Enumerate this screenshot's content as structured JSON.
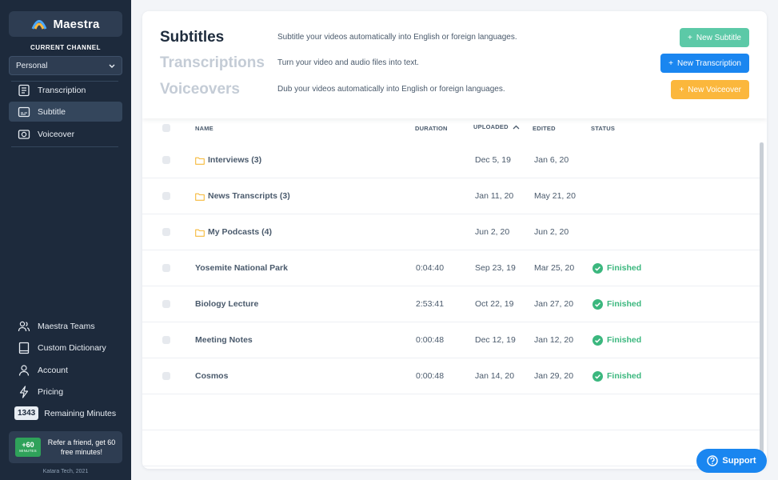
{
  "sidebar": {
    "brand": "Maestra",
    "channel_label": "CURRENT CHANNEL",
    "channel_value": "Personal",
    "nav": [
      {
        "label": "Transcription",
        "icon": "document-icon",
        "active": false
      },
      {
        "label": "Subtitle",
        "icon": "subtitle-icon",
        "active": true
      },
      {
        "label": "Voiceover",
        "icon": "camera-icon",
        "active": false
      }
    ],
    "bottom_nav": [
      {
        "label": "Maestra Teams",
        "icon": "users-icon"
      },
      {
        "label": "Custom Dictionary",
        "icon": "book-icon"
      },
      {
        "label": "Account",
        "icon": "user-icon"
      },
      {
        "label": "Pricing",
        "icon": "lightning-icon"
      }
    ],
    "minutes_count": "1343",
    "minutes_label": "Remaining Minutes",
    "refer_badge_big": "+60",
    "refer_badge_small": "MINUTES",
    "refer_text": "Refer a friend, get 60 free minutes!",
    "footer": "Katara Tech, 2021"
  },
  "header": {
    "products": [
      {
        "name": "Subtitles",
        "desc": "Subtitle your videos automatically into English or foreign languages.",
        "button": "New Subtitle",
        "color": "#5cc9a7",
        "active": true
      },
      {
        "name": "Transcriptions",
        "desc": "Turn your video and audio files into text.",
        "button": "New Transcription",
        "color": "#1a86f0",
        "active": false
      },
      {
        "name": "Voiceovers",
        "desc": "Dub your videos automatically into English or foreign languages.",
        "button": "New Voiceover",
        "color": "#fbb73c",
        "active": false
      }
    ]
  },
  "table": {
    "columns": {
      "name": "NAME",
      "duration": "DURATION",
      "uploaded": "UPLOADED",
      "edited": "EDITED",
      "status": "STATUS"
    },
    "rows": [
      {
        "name": "Interviews (3)",
        "folder": true,
        "duration": "",
        "uploaded": "Dec 5, 19",
        "edited": "Jan 6, 20",
        "status": ""
      },
      {
        "name": "News Transcripts (3)",
        "folder": true,
        "duration": "",
        "uploaded": "Jan 11, 20",
        "edited": "May 21, 20",
        "status": ""
      },
      {
        "name": "My Podcasts (4)",
        "folder": true,
        "duration": "",
        "uploaded": "Jun 2, 20",
        "edited": "Jun 2, 20",
        "status": ""
      },
      {
        "name": "Yosemite National Park",
        "folder": false,
        "duration": "0:04:40",
        "uploaded": "Sep 23, 19",
        "edited": "Mar 25, 20",
        "status": "Finished"
      },
      {
        "name": "Biology Lecture",
        "folder": false,
        "duration": "2:53:41",
        "uploaded": "Oct 22, 19",
        "edited": "Jan 27, 20",
        "status": "Finished"
      },
      {
        "name": "Meeting Notes",
        "folder": false,
        "duration": "0:00:48",
        "uploaded": "Dec 12, 19",
        "edited": "Jan 12, 20",
        "status": "Finished"
      },
      {
        "name": "Cosmos",
        "folder": false,
        "duration": "0:00:48",
        "uploaded": "Jan 14, 20",
        "edited": "Jan 29, 20",
        "status": "Finished"
      },
      {
        "name": "",
        "folder": false,
        "duration": "",
        "uploaded": "",
        "edited": "",
        "status": ""
      },
      {
        "name": "",
        "folder": false,
        "duration": "",
        "uploaded": "",
        "edited": "",
        "status": ""
      }
    ]
  },
  "support_label": "Support",
  "colors": {
    "sidebar": "#1d2a3c",
    "finished": "#3bb77e",
    "folder": "#f6b93b"
  }
}
